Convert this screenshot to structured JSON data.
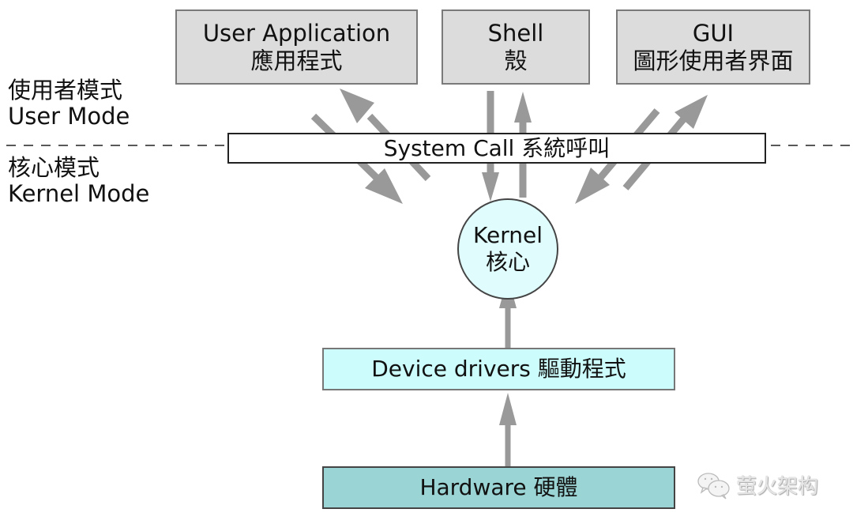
{
  "diagram": {
    "top_components": [
      {
        "en": "User Application",
        "zh": "應用程式"
      },
      {
        "en": "Shell",
        "zh": "殼"
      },
      {
        "en": "GUI",
        "zh": "圖形使用者界面"
      }
    ],
    "user_mode": {
      "zh": "使用者模式",
      "en": "User Mode"
    },
    "kernel_mode": {
      "zh": "核心模式",
      "en": "Kernel Mode"
    },
    "system_call": "System Call 系統呼叫",
    "kernel": {
      "en": "Kernel",
      "zh": "核心"
    },
    "drivers": "Device drivers 驅動程式",
    "hardware": "Hardware 硬體",
    "colors": {
      "app_fill": "#dcdcdc",
      "kernel_fill": "#e0fcfc",
      "drivers_fill": "#ccfcfc",
      "hardware_fill": "#9bd4d4",
      "arrow": "#999999"
    }
  },
  "watermark": {
    "text": "萤火架构",
    "icon": "wechat-icon"
  }
}
